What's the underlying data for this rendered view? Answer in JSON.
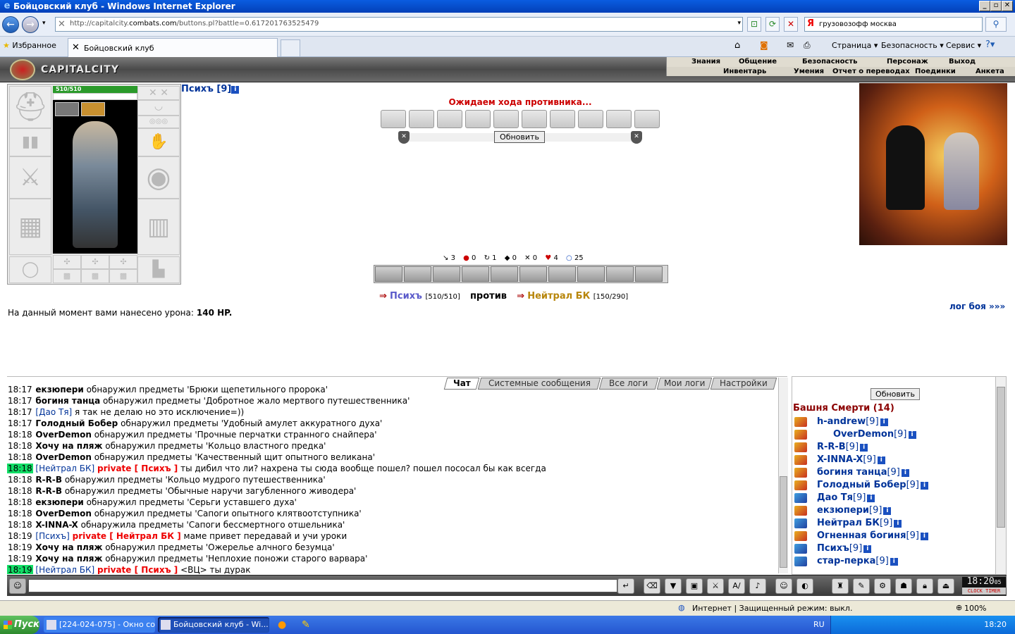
{
  "window": {
    "title": "Бойцовский клуб - Windows Internet Explorer"
  },
  "browser": {
    "url_prefix": "http://capitalcity.",
    "url_domain": "combats.com",
    "url_path": "/buttons.pl?battle=0.617201763525479",
    "search_query": "грузовозофф москва",
    "favorites_label": "Избранное",
    "tab_title": "Бойцовский клуб",
    "cmd_page": "Страница ▾",
    "cmd_security": "Безопасность ▾",
    "cmd_service": "Сервис ▾"
  },
  "game": {
    "city": "CAPITALCITY",
    "menu_top": [
      "Знания",
      "Общение",
      "Безопасность",
      "Персонаж",
      "Выход"
    ],
    "menu_bottom": [
      "Инвентарь",
      "Умения",
      "Отчет о переводах",
      "Поединки",
      "Анкета"
    ],
    "hp_text": "510/510",
    "player": "Психъ [9]",
    "waiting": "Ожидаем хода противника...",
    "refresh": "Обновить",
    "stats": {
      "s1": "3",
      "s2": "0",
      "s3": "1",
      "s4": "0",
      "s5": "0",
      "s6": "4",
      "s7": "25"
    },
    "vs": {
      "me": "Психъ",
      "me_hp": "[510/510]",
      "versus": "против",
      "opp": "Нейтрал БК",
      "opp_hp": "[150/290]"
    },
    "damage_text": "На данный момент вами нанесено урона:",
    "damage_value": "140 HP.",
    "log_link": "лог боя »»»"
  },
  "chat": {
    "tabs": [
      "Чат",
      "Системные сообщения",
      "Все логи",
      "Мои логи",
      "Настройки"
    ],
    "lines": [
      {
        "t": "18:17",
        "n": "екзюпери",
        "m": " обнаружил предметы 'Брюки щепетильного пророка'"
      },
      {
        "t": "18:17",
        "n": "богиня танца",
        "m": " обнаружил предметы 'Добротное жало мертвого путешественника'"
      },
      {
        "t": "18:17",
        "n": "[Дао Тя]",
        "m": " я так не делаю но это исключение=))",
        "sq": true
      },
      {
        "t": "18:17",
        "n": "Голодный Бобер",
        "m": " обнаружил предметы 'Удобный амулет аккуратного духа'"
      },
      {
        "t": "18:18",
        "n": "OverDemon",
        "m": " обнаружил предметы 'Прочные перчатки странного снайпера'"
      },
      {
        "t": "18:18",
        "n": "Хочу на пляж",
        "m": " обнаружил предметы 'Кольцо властного предка'"
      },
      {
        "t": "18:18",
        "n": "OverDemon",
        "m": " обнаружил предметы 'Качественный щит опытного великана'"
      },
      {
        "t": "18:18",
        "n": "[Нейтрал БК]",
        "p": "private [ Психъ ]",
        "m": " ты дибил что ли? нахрена ты сюда вообще пошел? пошел пососал бы как всегда",
        "sq": true,
        "hl": true
      },
      {
        "t": "18:18",
        "n": "R-R-B",
        "m": " обнаружил предметы 'Кольцо мудрого путешественника'"
      },
      {
        "t": "18:18",
        "n": "R-R-B",
        "m": " обнаружил предметы 'Обычные наручи загубленного живодера'"
      },
      {
        "t": "18:18",
        "n": "екзюпери",
        "m": " обнаружил предметы 'Серьги уставшего духа'"
      },
      {
        "t": "18:18",
        "n": "OverDemon",
        "m": " обнаружил предметы 'Сапоги опытного клятвоотступника'"
      },
      {
        "t": "18:18",
        "n": "X-INNA-X",
        "m": " обнаружила предметы 'Сапоги бессмертного отшельника'"
      },
      {
        "t": "18:19",
        "n": "[Психъ]",
        "p": "private [ Нейтрал БК ]",
        "m": " маме привет передавай и учи уроки",
        "sq": true
      },
      {
        "t": "18:19",
        "n": "Хочу на пляж",
        "m": " обнаружил предметы 'Ожерелье алчного безумца'"
      },
      {
        "t": "18:19",
        "n": "Хочу на пляж",
        "m": " обнаружил предметы 'Неплохие поножи старого варвара'"
      },
      {
        "t": "18:19",
        "n": "[Нейтрал БК]",
        "p": "private [ Психъ ]",
        "m": " <ВЦ> ты дурак",
        "sq": true,
        "hl": true
      }
    ]
  },
  "room": {
    "refresh": "Обновить",
    "title": "Башня Смерти (14)",
    "players": [
      {
        "n": "h-andrew",
        "l": "[9]",
        "c": "o"
      },
      {
        "n": "OverDemon",
        "l": "[9]",
        "c": "o"
      },
      {
        "n": "R-R-B",
        "l": "[9]",
        "c": "o"
      },
      {
        "n": "X-INNA-X",
        "l": "[9]",
        "c": "o"
      },
      {
        "n": "богиня танца",
        "l": "[9]",
        "c": "o"
      },
      {
        "n": "Голодный Бобер",
        "l": "[9]",
        "c": "o"
      },
      {
        "n": "Дао Тя",
        "l": "[9]",
        "c": "b"
      },
      {
        "n": "екзюпери",
        "l": "[9]",
        "c": "o"
      },
      {
        "n": "Нейтрал БК",
        "l": "[9]",
        "c": "b"
      },
      {
        "n": "Огненная богиня",
        "l": "[9]",
        "c": "o"
      },
      {
        "n": "Психъ",
        "l": "[9]",
        "c": "b"
      },
      {
        "n": "стар-перка",
        "l": "[9]",
        "c": "b"
      }
    ]
  },
  "clock": {
    "time": "18:20",
    "sec": "05",
    "label": "CLOCK TIMER"
  },
  "status": {
    "zone": "Интернет | Защищенный режим: выкл.",
    "zoom": "100%"
  },
  "taskbar": {
    "start": "Пуск",
    "task1": "[224-024-075] - Окно со...",
    "task2": "Бойцовский клуб - Wi...",
    "lang": "RU",
    "time": "18:20"
  }
}
